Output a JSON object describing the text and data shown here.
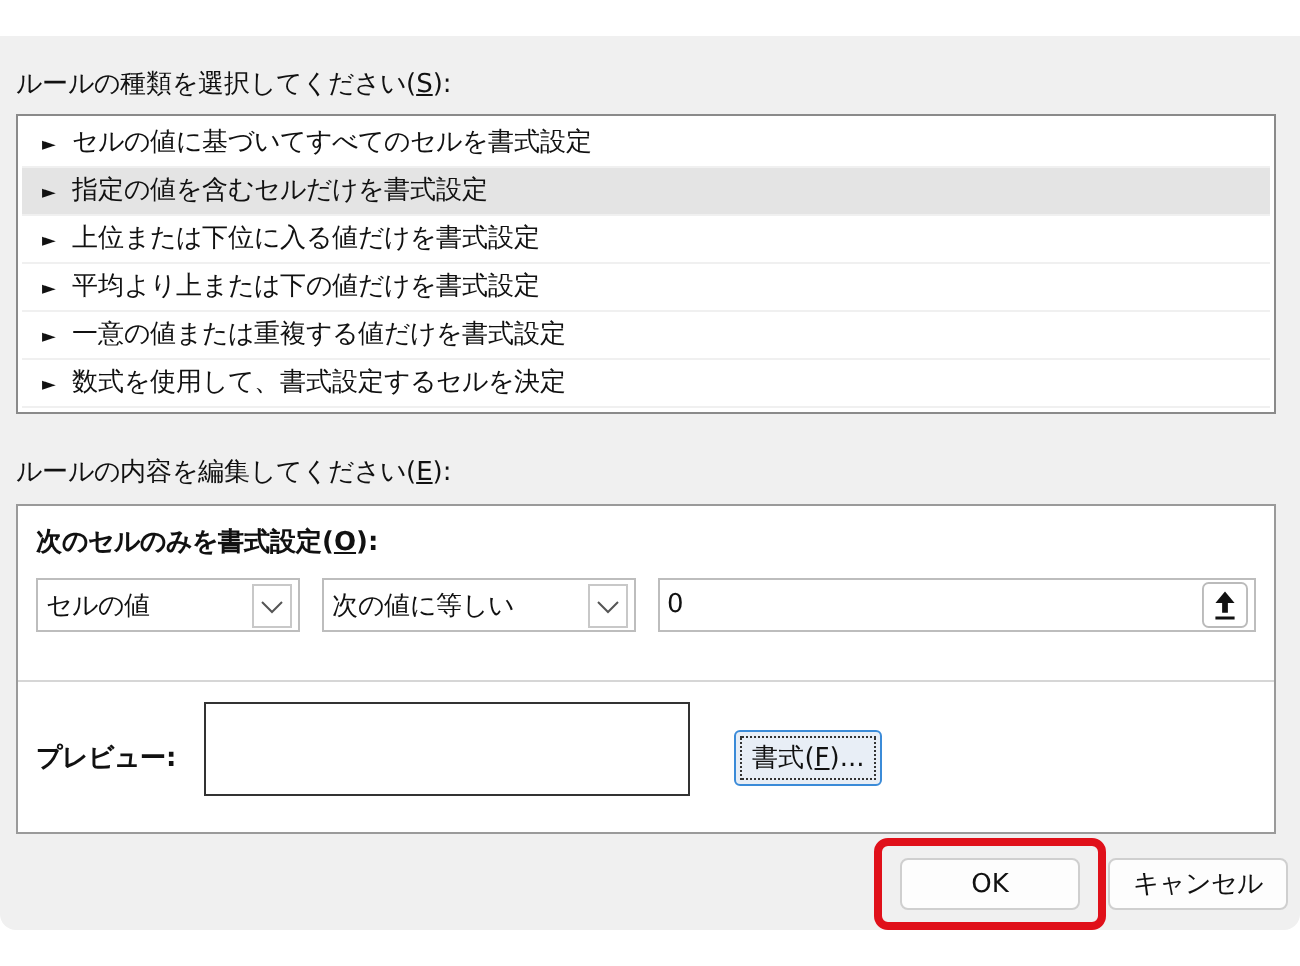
{
  "rule_type_label": {
    "before": "ルールの種類を選択してください(",
    "key": "S",
    "after": "):"
  },
  "rule_types": [
    {
      "marker": "►",
      "label": "セルの値に基づいてすべてのセルを書式設定",
      "selected": false
    },
    {
      "marker": "►",
      "label": "指定の値を含むセルだけを書式設定",
      "selected": true
    },
    {
      "marker": "►",
      "label": "上位または下位に入る値だけを書式設定",
      "selected": false
    },
    {
      "marker": "►",
      "label": "平均より上または下の値だけを書式設定",
      "selected": false
    },
    {
      "marker": "►",
      "label": "一意の値または重複する値だけを書式設定",
      "selected": false
    },
    {
      "marker": "►",
      "label": "数式を使用して、書式設定するセルを決定",
      "selected": false
    }
  ],
  "edit_label": {
    "before": "ルールの内容を編集してください(",
    "key": "E",
    "after": "):"
  },
  "condition_label": {
    "before": "次のセルのみを書式設定(",
    "key": "O",
    "after": "):"
  },
  "condition_field": "セルの値",
  "operator_field": "次の値に等しい",
  "value_field": "0",
  "preview_label": "プレビュー:",
  "format_button": {
    "before": "書式(",
    "key": "F",
    "after": ")..."
  },
  "buttons": [
    {
      "label": "OK",
      "highlighted": true
    },
    {
      "label": "キャンセル",
      "highlighted": false
    }
  ]
}
